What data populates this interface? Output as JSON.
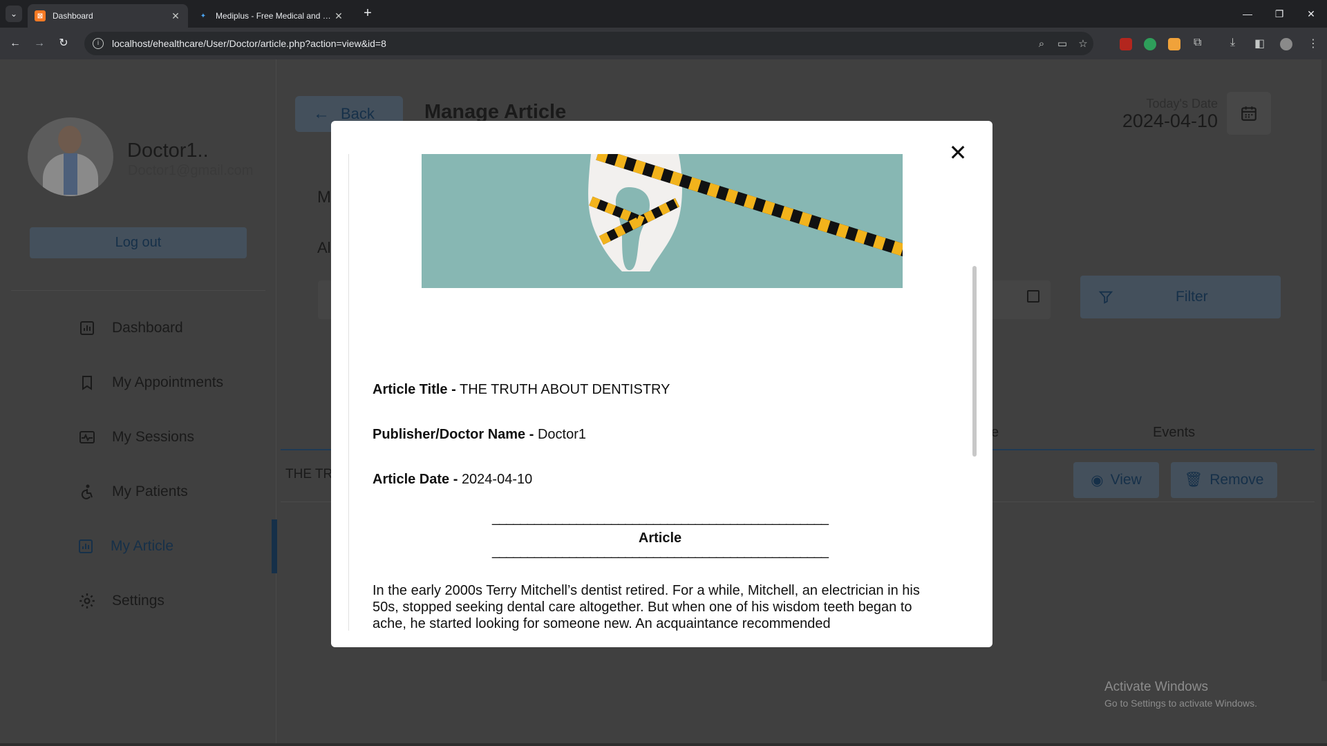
{
  "browser": {
    "tabs": [
      {
        "title": "Dashboard",
        "active": true
      },
      {
        "title": "Mediplus - Free Medical and Do",
        "active": false
      }
    ],
    "url": "localhost/ehealthcare/User/Doctor/article.php?action=view&id=8"
  },
  "profile": {
    "name": "Doctor1..",
    "email": "Doctor1@gmail.com",
    "logout_label": "Log out"
  },
  "sidebar": {
    "items": [
      {
        "label": "Dashboard",
        "icon": "dashboard-icon"
      },
      {
        "label": "My Appointments",
        "icon": "bookmark-icon"
      },
      {
        "label": "My Sessions",
        "icon": "sessions-icon"
      },
      {
        "label": "My Patients",
        "icon": "patients-icon"
      },
      {
        "label": "My Article",
        "icon": "article-icon",
        "active": true
      },
      {
        "label": "Settings",
        "icon": "gear-icon"
      }
    ]
  },
  "header": {
    "back_label": "Back",
    "title": "Manage Article",
    "date_label": "Today's Date",
    "date_value": "2024-04-10"
  },
  "background": {
    "frag_m": "M",
    "frag_al": "Al",
    "filter_label": "Filter",
    "th_frag": "e",
    "th_events": "Events",
    "row_frag": "THE TR",
    "view_label": "View",
    "remove_label": "Remove"
  },
  "modal": {
    "title_label": "Article Title -",
    "title_value": "THE TRUTH ABOUT DENTISTRY",
    "publisher_label": "Publisher/Doctor Name -",
    "publisher_value": "Doctor1",
    "date_label": "Article Date -",
    "date_value": "2024-04-10",
    "separator": "________________________________________________",
    "article_heading": "Article",
    "body": "In the early 2000s Terry Mitchell’s dentist retired. For a while, Mitchell, an electrician in his 50s, stopped seeking dental care altogether. But when one of his wisdom teeth began to ache, he started looking for someone new. An acquaintance recommended"
  },
  "watermark": {
    "line1": "Activate Windows",
    "line2": "Go to Settings to activate Windows."
  },
  "colors": {
    "accent": "#163049",
    "overlay_bg": "#404040",
    "hero_bg": "#87b7b3",
    "tape_yellow": "#f2b31c"
  }
}
